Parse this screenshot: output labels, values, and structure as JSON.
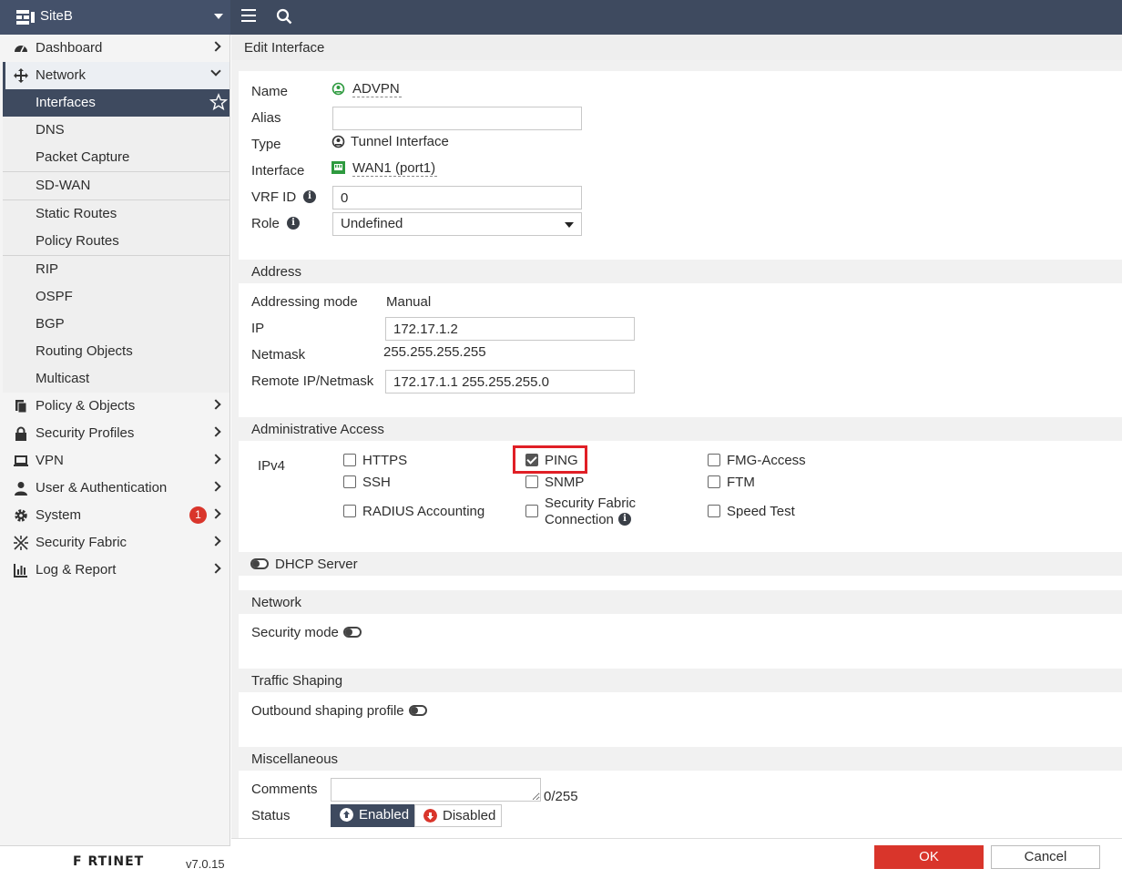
{
  "header": {
    "hostname": "SiteB",
    "colors": {
      "topbar": "#3e4a5f",
      "accent": "#d9352b"
    }
  },
  "sidebar": {
    "items": [
      {
        "label": "Dashboard",
        "icon": "dashboard-icon"
      },
      {
        "label": "Network",
        "icon": "network-icon"
      },
      {
        "label": "Interfaces"
      },
      {
        "label": "DNS"
      },
      {
        "label": "Packet Capture"
      },
      {
        "label": "SD-WAN"
      },
      {
        "label": "Static Routes"
      },
      {
        "label": "Policy Routes"
      },
      {
        "label": "RIP"
      },
      {
        "label": "OSPF"
      },
      {
        "label": "BGP"
      },
      {
        "label": "Routing Objects"
      },
      {
        "label": "Multicast"
      },
      {
        "label": "Policy & Objects",
        "icon": "policy-icon"
      },
      {
        "label": "Security Profiles",
        "icon": "lock-icon"
      },
      {
        "label": "VPN",
        "icon": "laptop-icon"
      },
      {
        "label": "User & Authentication",
        "icon": "user-icon"
      },
      {
        "label": "System",
        "icon": "gear-icon",
        "badge": "1"
      },
      {
        "label": "Security Fabric",
        "icon": "fabric-icon"
      },
      {
        "label": "Log & Report",
        "icon": "chart-icon"
      }
    ],
    "brand": "F RTINET",
    "version": "v7.0.15"
  },
  "page": {
    "title": "Edit Interface"
  },
  "form": {
    "name_label": "Name",
    "name_value": "ADVPN",
    "alias_label": "Alias",
    "alias_value": "",
    "type_label": "Type",
    "type_value": "Tunnel Interface",
    "interface_label": "Interface",
    "interface_value": "WAN1 (port1)",
    "vrf_label": "VRF ID",
    "vrf_value": "0",
    "role_label": "Role",
    "role_value": "Undefined"
  },
  "address": {
    "section": "Address",
    "mode_label": "Addressing mode",
    "mode_value": "Manual",
    "ip_label": "IP",
    "ip_value": "172.17.1.2",
    "netmask_label": "Netmask",
    "netmask_value": "255.255.255.255",
    "remote_label": "Remote IP/Netmask",
    "remote_value": "172.17.1.1 255.255.255.0"
  },
  "admin_access": {
    "section": "Administrative Access",
    "ipv4_label": "IPv4",
    "options": [
      {
        "label": "HTTPS",
        "checked": false
      },
      {
        "label": "PING",
        "checked": true
      },
      {
        "label": "FMG-Access",
        "checked": false
      },
      {
        "label": "SSH",
        "checked": false
      },
      {
        "label": "SNMP",
        "checked": false
      },
      {
        "label": "FTM",
        "checked": false
      },
      {
        "label": "RADIUS Accounting",
        "checked": false
      },
      {
        "label_line1": "Security Fabric",
        "label_line2": "Connection",
        "checked": false
      },
      {
        "label": "Speed Test",
        "checked": false
      }
    ]
  },
  "dhcp": {
    "label": "DHCP Server",
    "enabled": false
  },
  "network": {
    "section": "Network",
    "security_mode_label": "Security mode",
    "security_mode_enabled": false
  },
  "traffic": {
    "section": "Traffic Shaping",
    "outbound_label": "Outbound shaping profile",
    "outbound_enabled": false
  },
  "misc": {
    "section": "Miscellaneous",
    "comments_label": "Comments",
    "comments_value": "",
    "comments_count": "0/255",
    "status_label": "Status",
    "enabled_label": "Enabled",
    "disabled_label": "Disabled"
  },
  "footer": {
    "ok": "OK",
    "cancel": "Cancel"
  }
}
